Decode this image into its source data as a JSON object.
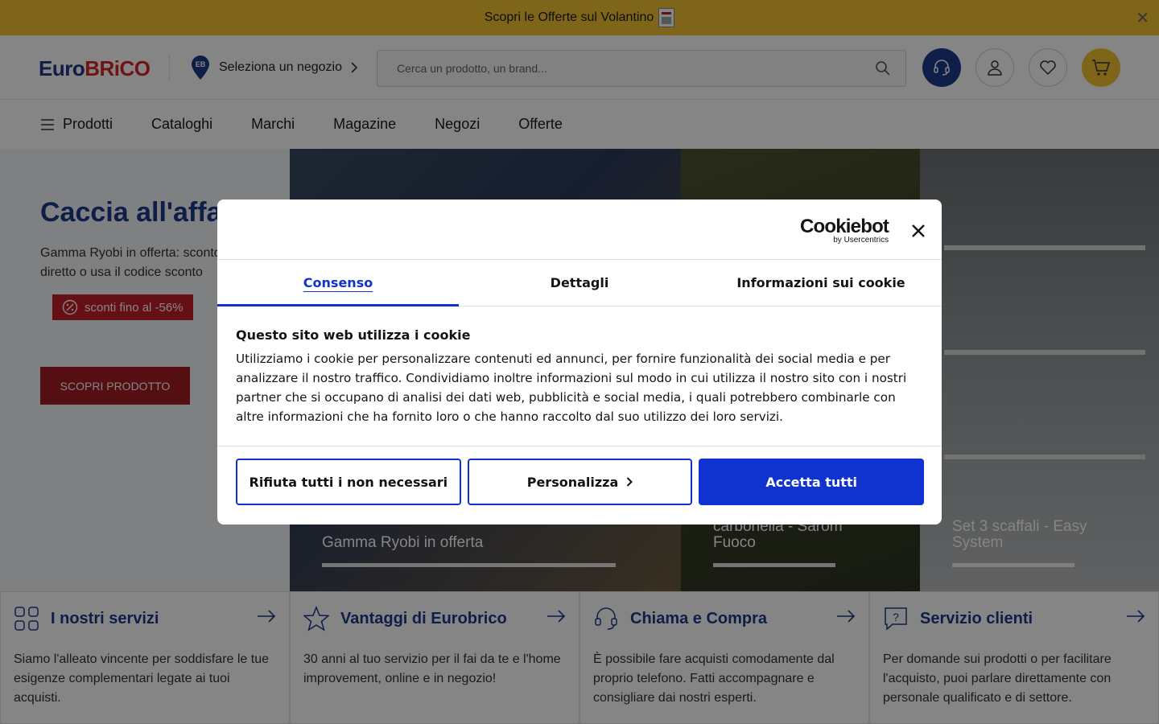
{
  "topbar": {
    "promo_text": "Scopri le Offerte sul Volantino",
    "close_icon": "close-icon"
  },
  "header": {
    "logo_part1": "Euro",
    "logo_part2": "BRiCO",
    "store_label": "Seleziona un negozio",
    "store_pin_text": "EB",
    "search_placeholder": "Cerca un prodotto, un brand...",
    "icons": [
      "support-headset-icon",
      "user-icon",
      "heart-icon",
      "cart-icon"
    ]
  },
  "nav": {
    "items": [
      {
        "label": "Prodotti"
      },
      {
        "label": "Cataloghi"
      },
      {
        "label": "Marchi"
      },
      {
        "label": "Magazine"
      },
      {
        "label": "Negozi"
      },
      {
        "label": "Offerte"
      }
    ]
  },
  "hero": {
    "title": "Caccia all'affare",
    "description": "Gamma Ryobi in offerta: sconto diretto o usa il codice sconto",
    "badge": "sconti fino al -56%",
    "cta": "SCOPRI PRODOTTO",
    "panels": [
      {
        "title": "Gamma Ryobi in offerta"
      },
      {
        "title": "carbonella - Sarom Fuoco"
      },
      {
        "title": "Set 3 scaffali - Easy System"
      }
    ]
  },
  "services": [
    {
      "title": "I nostri servizi",
      "icon": "grid-icon",
      "desc": "Siamo l'alleato vincente per soddisfare le tue esigenze complementari legate ai tuoi acquisti."
    },
    {
      "title": "Vantaggi di Eurobrico",
      "icon": "star-icon",
      "desc": "30 anni al tuo servizio per il fai da te e l'home improvement, online e in negozio!"
    },
    {
      "title": "Chiama e Compra",
      "icon": "headset-icon",
      "desc": "È possibile fare acquisti comodamente dal proprio telefono. Fatti accompagnare e consigliare dai nostri esperti."
    },
    {
      "title": "Servizio clienti",
      "icon": "question-bubble-icon",
      "desc": "Per domande sui prodotti o per facilitare l'acquisto, puoi parlare direttamente con personale qualificato e di settore."
    }
  ],
  "cookie_dialog": {
    "brand": "Cookiebot",
    "brand_sub": "by Usercentrics",
    "tabs": [
      "Consenso",
      "Dettagli",
      "Informazioni sui cookie"
    ],
    "heading": "Questo sito web utilizza i cookie",
    "body": "Utilizziamo i cookie per personalizzare contenuti ed annunci, per fornire funzionalità dei social media e per analizzare il nostro traffico. Condividiamo inoltre informazioni sul modo in cui utilizza il nostro sito con i nostri partner che si occupano di analisi dei dati web, pubblicità e social media, i quali potrebbero combinarle con altre informazioni che ha fornito loro o che hanno raccolto dal suo utilizzo dei loro servizi.",
    "buttons": {
      "reject": "Rifiuta tutti i non necessari",
      "customize": "Personalizza",
      "accept": "Accetta tutti"
    }
  },
  "colors": {
    "brand_blue": "#1d3b8c",
    "brand_red": "#c0202a",
    "yellow": "#f2c230",
    "cookiebot_blue": "#1032cf"
  }
}
